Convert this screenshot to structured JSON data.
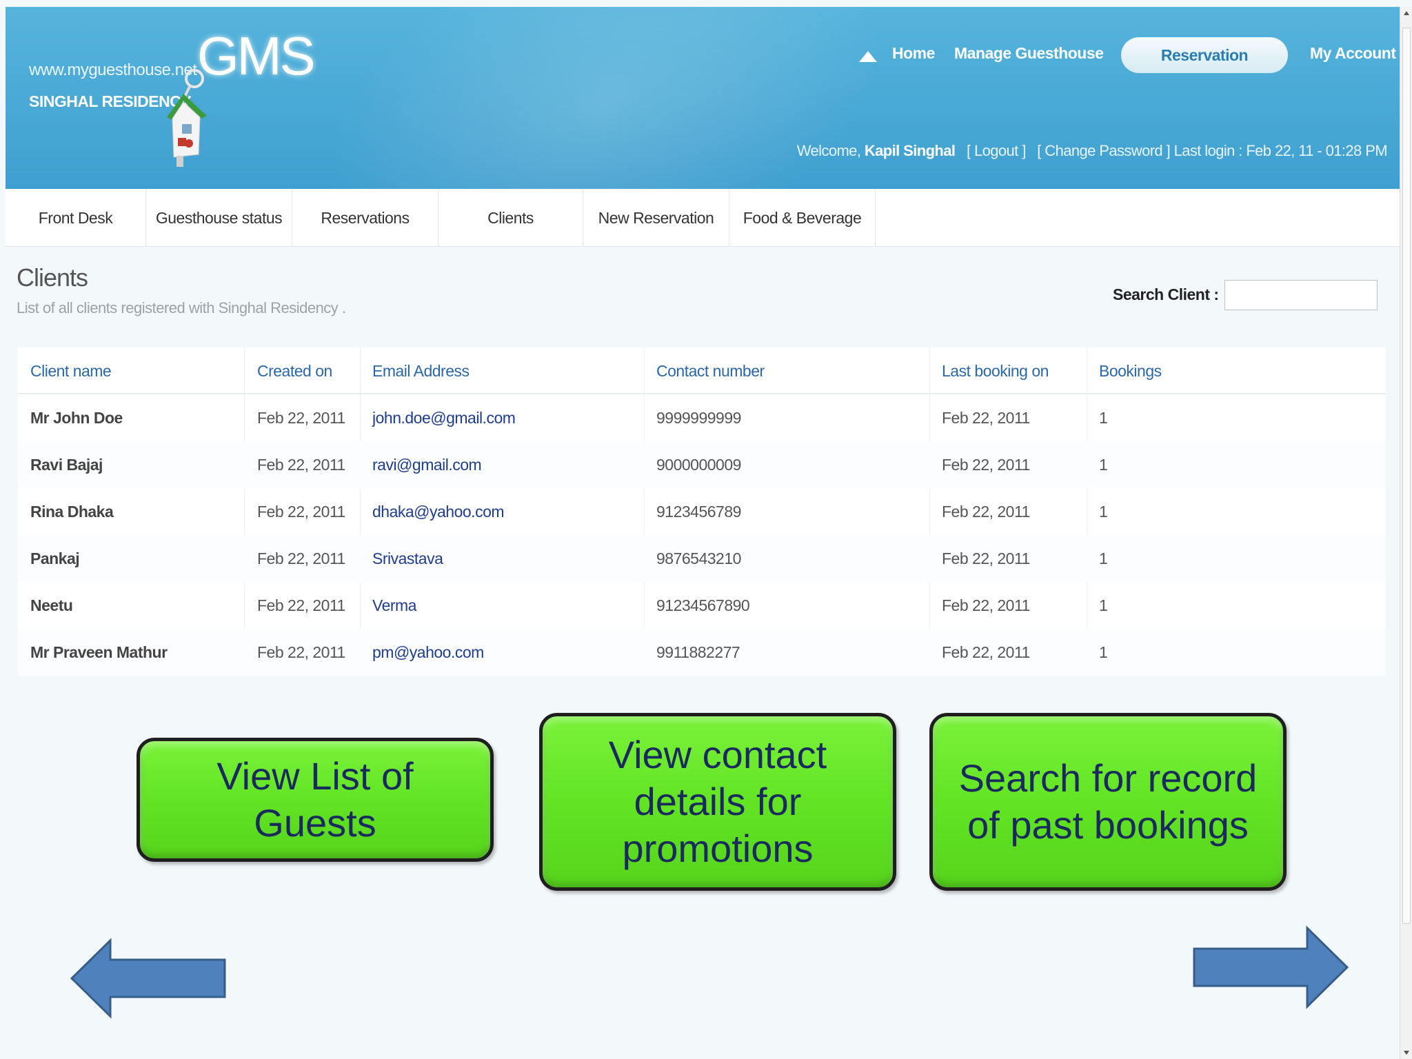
{
  "header": {
    "site_url": "www.myguesthouse.net",
    "site_name": "SINGHAL RESIDENCY",
    "logo_text": "GMS",
    "logo_icon": "house-key-icon",
    "nav": {
      "home": "Home",
      "manage": "Manage Guesthouse",
      "reservation": "Reservation",
      "account": "My Account"
    },
    "welcome": {
      "prefix": "Welcome,",
      "user": "Kapil Singhal",
      "logout": "[ Logout ]",
      "change_password": "[ Change Password ]",
      "last_login": "Last login : Feb 22, 11 - 01:28 PM"
    }
  },
  "tabs": [
    "Front Desk",
    "Guesthouse status",
    "Reservations",
    "Clients",
    "New Reservation",
    "Food & Beverage"
  ],
  "page": {
    "title": "Clients",
    "subtitle": "List of all clients registered with Singhal Residency .",
    "search_label": "Search Client :",
    "search_value": ""
  },
  "table": {
    "columns": [
      "Client name",
      "Created on",
      "Email Address",
      "Contact number",
      "Last booking on",
      "Bookings"
    ],
    "rows": [
      [
        "Mr John Doe",
        "Feb 22, 2011",
        "john.doe@gmail.com",
        "9999999999",
        "Feb 22, 2011",
        "1"
      ],
      [
        "Ravi Bajaj",
        "Feb 22, 2011",
        "ravi@gmail.com",
        "9000000009",
        "Feb 22, 2011",
        "1"
      ],
      [
        "Rina Dhaka",
        "Feb 22, 2011",
        "dhaka@yahoo.com",
        "9123456789",
        "Feb 22, 2011",
        "1"
      ],
      [
        "Pankaj",
        "Feb 22, 2011",
        "Srivastava",
        "9876543210",
        "Feb 22, 2011",
        "1"
      ],
      [
        "Neetu",
        "Feb 22, 2011",
        "Verma",
        "91234567890",
        "Feb 22, 2011",
        "1"
      ],
      [
        "Mr Praveen Mathur",
        "Feb 22, 2011",
        "pm@yahoo.com",
        "9911882277",
        "Feb 22, 2011",
        "1"
      ]
    ]
  },
  "callouts": {
    "one_line1": "View List of",
    "one_line2": "Guests",
    "two_line1": "View contact",
    "two_line2": "details for",
    "two_line3": "promotions",
    "three_line1": "Search for record",
    "three_line2": "of past bookings"
  },
  "arrows": {
    "prev_icon": "left-arrow-icon",
    "next_icon": "right-arrow-icon"
  },
  "colors": {
    "header": "#4aaad6",
    "callout": "#62e424",
    "arrow": "#4f81bd",
    "link": "#2a67a8"
  }
}
